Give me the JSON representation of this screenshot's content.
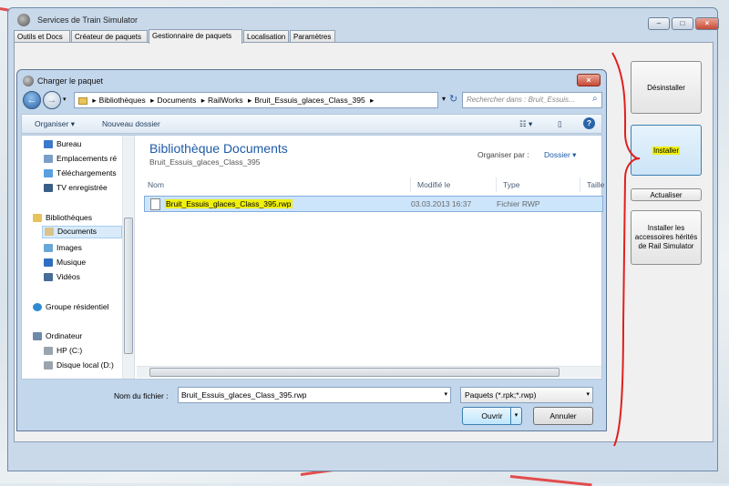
{
  "colors": {
    "highlight": "#f0f010",
    "annotation": "#e02020",
    "link_blue": "#1e5aa8"
  },
  "main_window": {
    "title": "Services de Train Simulator",
    "controls": [
      "minimize-icon",
      "maximize-icon",
      "close-icon"
    ]
  },
  "tabs": [
    {
      "label": "Outils et Docs"
    },
    {
      "label": "Créateur de paquets"
    },
    {
      "label": "Gestionnaire de paquets",
      "active": true
    },
    {
      "label": "Localisation"
    },
    {
      "label": "Paramètres"
    }
  ],
  "side_buttons": {
    "desinstaller": "Désinstaller",
    "installer": "Installer",
    "actualiser": "Actualiser",
    "installer_accessoires": "Installer les accessoires hérités de Rail Simulator"
  },
  "dialog": {
    "title": "Charger le paquet",
    "breadcrumb": [
      "Bibliothèques",
      "Documents",
      "RailWorks",
      "Bruit_Essuis_glaces_Class_395"
    ],
    "search_placeholder": "Rechercher dans : Bruit_Essuis...",
    "toolbar": {
      "organiser": "Organiser",
      "nouveau_dossier": "Nouveau dossier"
    },
    "nav_items": [
      {
        "label": "Bureau",
        "icon": "desktop-icon"
      },
      {
        "label": "Emplacements ré",
        "icon": "places-icon"
      },
      {
        "label": "Téléchargements",
        "icon": "downloads-icon"
      },
      {
        "label": "TV enregistrée",
        "icon": "tv-icon"
      },
      {
        "label": "Bibliothèques",
        "icon": "library-icon"
      },
      {
        "label": "Documents",
        "icon": "documents-icon",
        "selected": true
      },
      {
        "label": "Images",
        "icon": "images-icon"
      },
      {
        "label": "Musique",
        "icon": "music-icon"
      },
      {
        "label": "Vidéos",
        "icon": "videos-icon"
      },
      {
        "label": "Groupe résidentiel",
        "icon": "homegroup-icon"
      },
      {
        "label": "Ordinateur",
        "icon": "computer-icon"
      },
      {
        "label": "HP (C:)",
        "icon": "drive-icon"
      },
      {
        "label": "Disque local (D:)",
        "icon": "drive-icon"
      }
    ],
    "library": {
      "title": "Bibliothèque Documents",
      "subtitle": "Bruit_Essuis_glaces_Class_395",
      "arrange_label": "Organiser par :",
      "arrange_value": "Dossier"
    },
    "columns": [
      "Nom",
      "Modifié le",
      "Type",
      "Taille"
    ],
    "files": [
      {
        "name": "Bruit_Essuis_glaces_Class_395.rwp",
        "modified": "03.03.2013 16:37",
        "type": "Fichier RWP",
        "size": ""
      }
    ],
    "filename_label": "Nom du fichier :",
    "filename_value": "Bruit_Essuis_glaces_Class_395.rwp",
    "filter_value": "Paquets (*.rpk;*.rwp)",
    "ouvrir": "Ouvrir",
    "annuler": "Annuler"
  }
}
